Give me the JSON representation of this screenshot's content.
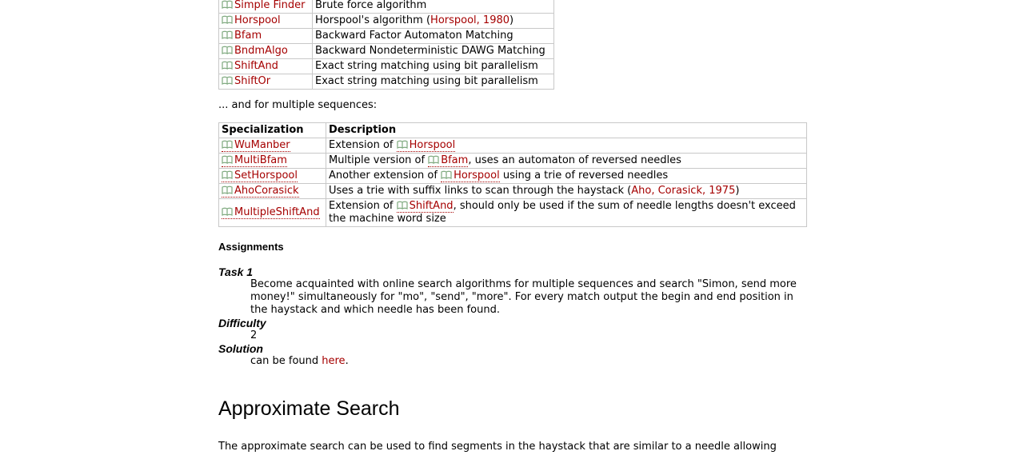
{
  "single_table": {
    "rows": [
      {
        "name": "Simple Finder",
        "desc": "Brute force algorithm"
      },
      {
        "name": "Horspool",
        "desc_pre": "Horspool's algorithm (",
        "cite": "Horspool, 1980",
        "desc_post": ")"
      },
      {
        "name": "Bfam",
        "desc": "Backward Factor Automaton Matching"
      },
      {
        "name": "BndmAlgo",
        "desc": "Backward Nondeterministic DAWG Matching"
      },
      {
        "name": "ShiftAnd",
        "desc": "Exact string matching using bit parallelism"
      },
      {
        "name": "ShiftOr",
        "desc": "Exact string matching using bit parallelism"
      }
    ]
  },
  "multi_intro": "... and for multiple sequences:",
  "multi_table": {
    "headers": [
      "Specialization",
      "Description"
    ],
    "rows": [
      {
        "name": "WuManber",
        "pre": "Extension of ",
        "link": "Horspool",
        "post": ""
      },
      {
        "name": "MultiBfam",
        "pre": "Multiple version of ",
        "link": "Bfam",
        "post": ", uses an automaton of reversed needles"
      },
      {
        "name": "SetHorspool",
        "pre": "Another extension of ",
        "link": "Horspool",
        "post": " using a trie of reversed needles"
      },
      {
        "name": "AhoCorasick",
        "pre": "Uses a trie with suffix links to scan through the haystack (",
        "cite": "Aho, Corasick, 1975",
        "post": ")"
      },
      {
        "name": "MultipleShiftAnd",
        "pre": "Extension of ",
        "link": "ShiftAnd",
        "post": ", should only be used if the sum of needle lengths doesn't exceed the machine word size"
      }
    ]
  },
  "assignments": {
    "heading": "Assignments",
    "task_label": "Task 1",
    "task_text": "Become acquainted with online search algorithms for multiple sequences and search \"Simon, send more money!\" simultaneously for \"mo\", \"send\", \"more\". For every match output the begin and end position in the haystack and which needle has been found.",
    "difficulty_label": "Difficulty",
    "difficulty_value": "2",
    "solution_label": "Solution",
    "solution_pre": "can be found ",
    "solution_link": "here",
    "solution_post": "."
  },
  "approx": {
    "heading": "Approximate Search",
    "paragraph": "The approximate search can be used to find segments in the haystack that are similar to a needle allowing"
  },
  "colors": {
    "link": "#a50000",
    "icon": "#7da87d",
    "border": "#c8c8c8"
  },
  "icon_name": "book-icon"
}
